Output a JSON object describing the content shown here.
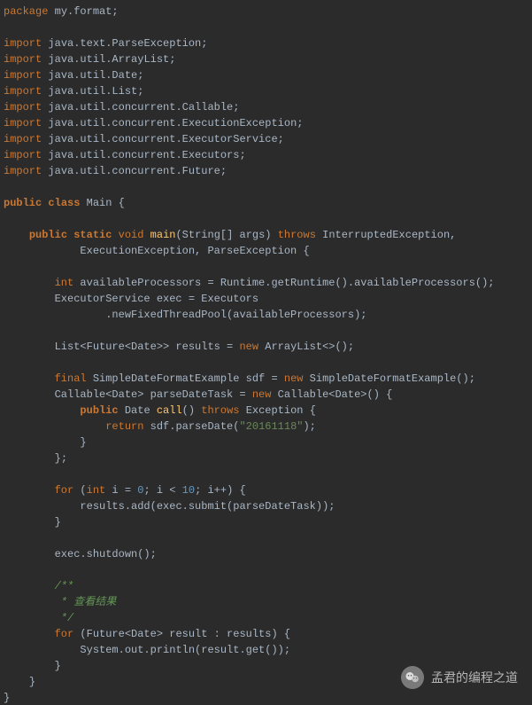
{
  "code": {
    "package_kw": "package",
    "package_name": " my.format;",
    "import_kw": "import",
    "imports": [
      " java.text.ParseException;",
      " java.util.ArrayList;",
      " java.util.Date;",
      " java.util.List;",
      " java.util.concurrent.Callable;",
      " java.util.concurrent.ExecutionException;",
      " java.util.concurrent.ExecutorService;",
      " java.util.concurrent.Executors;",
      " java.util.concurrent.Future;"
    ],
    "public_kw": "public",
    "class_kw": "class",
    "class_name": " Main ",
    "lbrace": "{",
    "rbrace": "}",
    "static_kw": "static",
    "void_kw": "void",
    "main_name": "main",
    "main_params": "(String[] args) ",
    "throws_kw": "throws",
    "throws1": " InterruptedException,",
    "throws2": "ExecutionException, ParseException ",
    "int_kw": "int",
    "line_avail": " availableProcessors = Runtime.getRuntime().availableProcessors();",
    "line_exec1": "ExecutorService exec = Executors",
    "line_exec2": ".newFixedThreadPool(availableProcessors);",
    "list_decl1": "List<Future<Date>> results = ",
    "new_kw": "new",
    "list_decl2": " ArrayList<>();",
    "final_kw": "final",
    "sdf_decl1": " SimpleDateFormatExample sdf = ",
    "sdf_decl2": " SimpleDateFormatExample();",
    "callable_decl1": "Callable<Date> parseDateTask = ",
    "callable_decl2": " Callable<Date>() ",
    "date_type": " Date ",
    "call_name": "call",
    "call_params": "() ",
    "call_throws": " Exception ",
    "return_kw": "return",
    "return_expr1": " sdf.parseDate(",
    "string_literal": "\"20161118\"",
    "return_expr2": ");",
    "anon_end": ";",
    "for_kw": "for",
    "for_open": " (",
    "for_init": " i = ",
    "zero": "0",
    "for_cond": "; i < ",
    "ten": "10",
    "for_post": "; i++) ",
    "results_add": "results.add(exec.submit(parseDateTask));",
    "shutdown": "exec.shutdown();",
    "jdoc_open": "/**",
    "jdoc_line": " * 查看结果",
    "jdoc_close": " */",
    "foreach_head": " (Future<Date> result : results) ",
    "println": "System.out.println(result.get());"
  },
  "watermark": {
    "text": "孟君的编程之道",
    "icon_name": "wechat-icon"
  }
}
